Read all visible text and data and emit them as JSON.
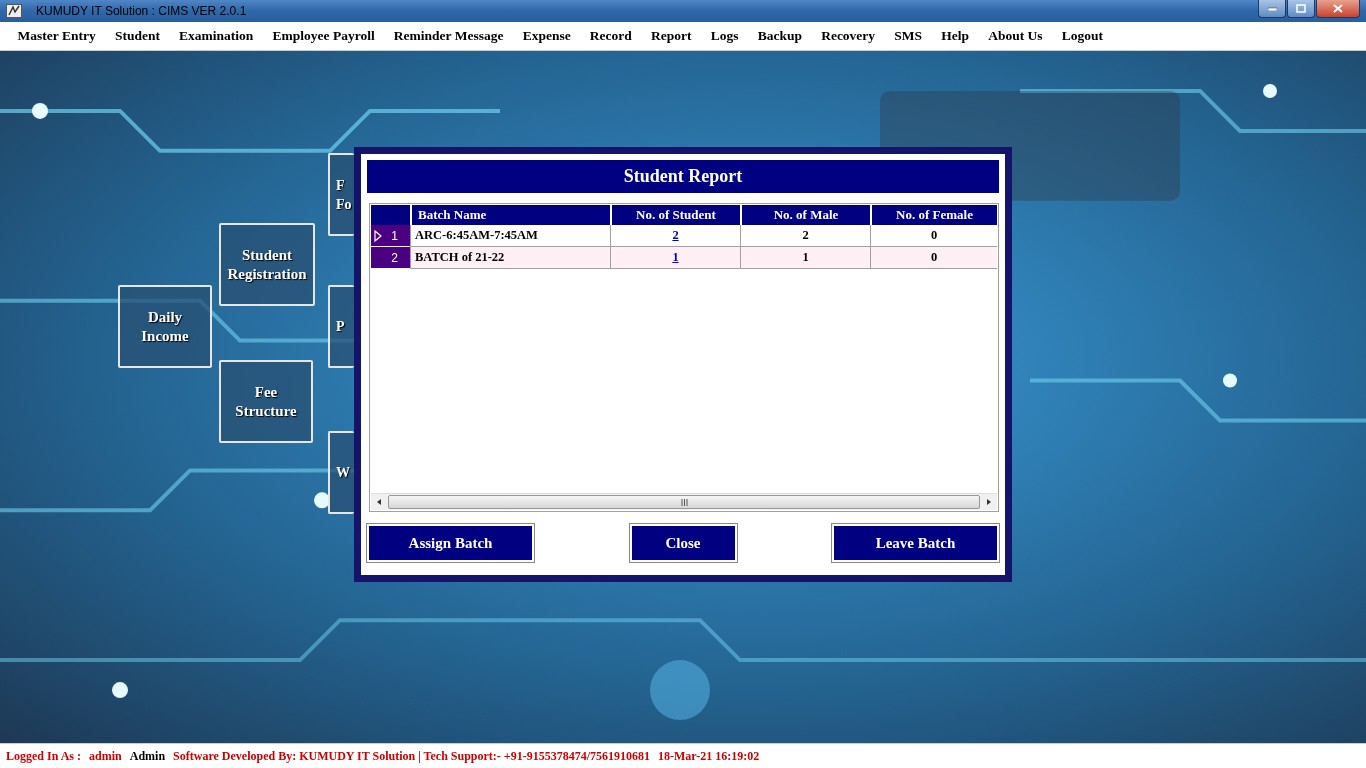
{
  "window": {
    "title": "KUMUDY IT Solution : CIMS VER 2.0.1"
  },
  "menu": [
    "Master Entry",
    "Student",
    "Examination",
    "Employee Payroll",
    "Reminder Message",
    "Expense",
    "Record",
    "Report",
    "Logs",
    "Backup",
    "Recovery",
    "SMS",
    "Help",
    "About Us",
    "Logout"
  ],
  "tiles": [
    {
      "kind": "full",
      "lines": [
        "Daily",
        "Income"
      ]
    },
    {
      "kind": "full",
      "lines": [
        "Student",
        "Registration"
      ]
    },
    {
      "kind": "full",
      "lines": [
        "Fee",
        "Structure"
      ]
    },
    {
      "kind": "partial",
      "lines": [
        "F",
        "Fo"
      ]
    },
    {
      "kind": "partial",
      "lines": [
        "P"
      ]
    },
    {
      "kind": "partial",
      "lines": [
        "W"
      ]
    }
  ],
  "dialog": {
    "title": "Student Report",
    "table": {
      "columns": [
        {
          "label": "Batch Name",
          "kind": "text"
        },
        {
          "label": "No. of Student",
          "kind": "link"
        },
        {
          "label": "No. of Male",
          "kind": "number"
        },
        {
          "label": "No. of Female",
          "kind": "number"
        }
      ],
      "rows": [
        {
          "number": "1",
          "current": true,
          "cells": [
            "ARC-6:45AM-7:45AM",
            "2",
            "2",
            "0"
          ]
        },
        {
          "number": "2",
          "current": false,
          "cells": [
            "BATCH of 21-22",
            "1",
            "1",
            "0"
          ]
        }
      ]
    },
    "buttons": [
      "Assign Batch",
      "Close",
      "Leave Batch"
    ]
  },
  "status_bar": [
    {
      "text": "Logged In As :",
      "color": "#cc0000"
    },
    {
      "text": "admin",
      "color": "#cc0000"
    },
    {
      "text": "Admin",
      "color": "#000000"
    },
    {
      "text": "Software Developed By: KUMUDY IT Solution | Tech Support:- +91-9155378474/7561910681",
      "color": "#cc0000"
    },
    {
      "text": "18-Mar-21 16:19:02",
      "color": "#cc0000"
    }
  ]
}
